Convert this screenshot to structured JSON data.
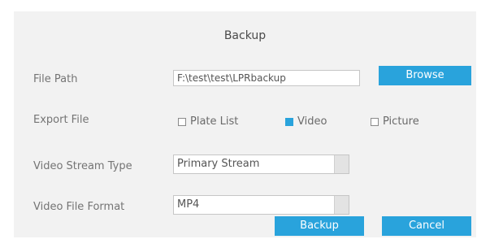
{
  "dialog": {
    "title": "Backup"
  },
  "file_path": {
    "label": "File Path",
    "value": "F:\\test\\test\\LPRbackup",
    "browse_label": "Browse"
  },
  "export_file": {
    "label": "Export File",
    "options": [
      {
        "label": "Plate List",
        "checked": false
      },
      {
        "label": "Video",
        "checked": true
      },
      {
        "label": "Picture",
        "checked": false
      }
    ]
  },
  "stream_type": {
    "label": "Video Stream Type",
    "value": "Primary Stream"
  },
  "file_format": {
    "label": "Video File Format",
    "value": "MP4"
  },
  "actions": {
    "backup_label": "Backup",
    "cancel_label": "Cancel"
  },
  "colors": {
    "accent": "#29a3dc",
    "panel": "#f2f2f2"
  }
}
